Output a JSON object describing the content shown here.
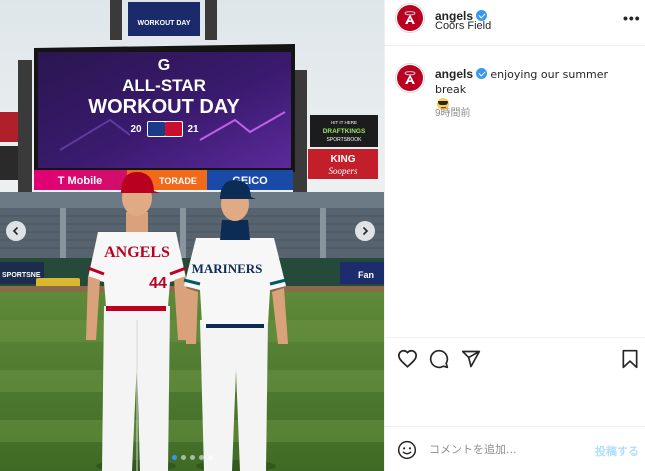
{
  "header": {
    "username": "angels",
    "location": "Coors Field",
    "more_label": "•••"
  },
  "caption": {
    "username": "angels",
    "text": "enjoying our summer break",
    "emoji": "smiling-face-with-sunglasses",
    "time_ago": "9時間前"
  },
  "media": {
    "scoreboard": {
      "sponsor_letter": "G",
      "title_line1": "ALL-STAR",
      "title_line2": "WORKOUT DAY",
      "year_left": "20",
      "year_right": "21",
      "top_badge": "WORKOUT DAY",
      "ads": [
        "T Mobile",
        "TORADE",
        "GEICO"
      ]
    },
    "side_signs": {
      "draftkings_line1": "HIT IT HERE",
      "draftkings_line2": "DRAFTKINGS",
      "draftkings_line3": "SPORTSBOOK",
      "king_line1": "KING",
      "king_line2": "Soopers"
    },
    "wall_signs": [
      "SPORTSNE",
      "Fan"
    ],
    "players": [
      {
        "jersey": "ANGELS",
        "number": "44",
        "team_color": "#ba0021"
      },
      {
        "jersey": "MARINERS",
        "number": "",
        "team_color": "#0c2c56"
      }
    ],
    "carousel": {
      "count": 5,
      "active_index": 0
    }
  },
  "actions": {
    "like": "heart-icon",
    "comment": "comment-icon",
    "share": "share-icon",
    "save": "bookmark-icon"
  },
  "comment_box": {
    "placeholder": "コメントを追加...",
    "post_label": "投稿する"
  },
  "colors": {
    "angels_red": "#ba0021",
    "verified_blue": "#3897f0",
    "post_disabled": "#b2dffc",
    "muted": "#8e8e8e"
  }
}
